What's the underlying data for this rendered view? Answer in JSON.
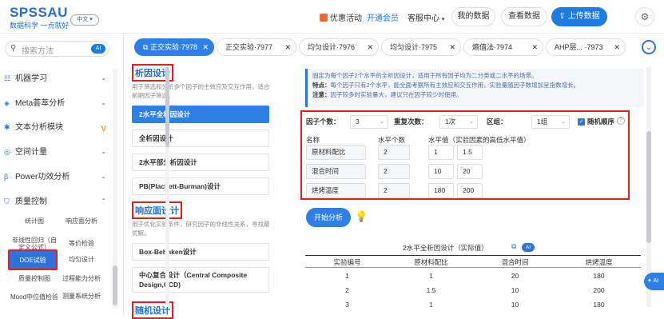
{
  "brand": {
    "logo": "SPSSAU",
    "tagline": "数据科学 一点就好",
    "lang": "中文"
  },
  "topnav": {
    "promo": "优惠活动",
    "member": "开通会员",
    "service": "客服中心",
    "my_data": "我的数据",
    "view_data": "查看数据",
    "upload": "上传数据",
    "settings_icon": "gear-icon"
  },
  "sidebar": {
    "search_placeholder": "搜索方法",
    "search_ai": "AI",
    "menu": [
      {
        "label": "机器学习",
        "icon": "ml-icon"
      },
      {
        "label": "Meta荟萃分析",
        "icon": "meta-icon"
      },
      {
        "label": "文本分析模块",
        "icon": "text-icon"
      },
      {
        "label": "空间计量",
        "icon": "spatial-icon"
      },
      {
        "label": "Power功效分析",
        "icon": "power-icon"
      },
      {
        "label": "质量控制",
        "icon": "quality-icon"
      }
    ],
    "sub": [
      "统计图",
      "响应面分析",
      "非线性回归（自定义公式）",
      "等价检验",
      "DOE试验",
      "均匀设计",
      "质量控制图",
      "过程能力分析",
      "Mood中位值检验",
      "测量系统分析"
    ]
  },
  "tabs": [
    {
      "label": "正交实验·7978"
    },
    {
      "label": "正交实验·7977"
    },
    {
      "label": "均匀设计·7976"
    },
    {
      "label": "均匀设计·7975"
    },
    {
      "label": "熵值法·7974"
    },
    {
      "label": "AHP层... ·7973"
    }
  ],
  "left_panel": {
    "section1_title": "析因设计",
    "section1_desc": "用于筛选和分析多个因子的主效应及交互作用，适合前期因子筛选。",
    "section1_items": [
      "2水平全析因设计",
      "全析因设计",
      "2水平部分析因设计",
      "PB(Plackett-Burman)设计"
    ],
    "section2_title": "响应面设计",
    "section2_desc": "用于优化实验条件，研究因子的非线性关系，寻找最优解。",
    "section2_items": [
      "Box-Behnken设计",
      "中心复合设计（Central Composite Design,CCD)"
    ],
    "section3_title": "随机设计"
  },
  "info": {
    "line1": "固定为每个因子2个水平的全析因设计，适用于所有因子均为二分类或二水平的场景。",
    "line2_label": "特点：",
    "line2": "每个因子只有2个水平，能全面考察所有主效应和交互作用，实验量随因子数增加呈指数增长。",
    "line3_label": "注意：",
    "line3": "因子较多时实验量大，建议只在因子较少时使用。"
  },
  "config": {
    "factor_count_label": "因子个数：",
    "factor_count": "3",
    "repeat_label": "重复次数：",
    "repeat": "1次",
    "block_label": "区组：",
    "block": "1组",
    "random_label": "随机顺序",
    "col_name": "名称",
    "col_levels": "水平个数",
    "col_values": "水平值（实验因素的高低水平值）",
    "factors": [
      {
        "name": "原材料配比",
        "levels": "2",
        "v1": "1",
        "v2": "1.5"
      },
      {
        "name": "混合时间",
        "levels": "2",
        "v1": "10",
        "v2": "20"
      },
      {
        "name": "烘烤温度",
        "levels": "2",
        "v1": "180",
        "v2": "200"
      }
    ]
  },
  "run_button": "开始分析",
  "result": {
    "title": "2水平全析因设计（实际值）",
    "ai": "AI",
    "headers": [
      "实验编号",
      "原材料配比",
      "混合时间",
      "烘烤温度"
    ],
    "rows": [
      [
        "1",
        "1",
        "20",
        "180"
      ],
      [
        "2",
        "1.5",
        "10",
        "200"
      ],
      [
        "3",
        "1",
        "10",
        "180"
      ]
    ]
  },
  "fab": "AI"
}
